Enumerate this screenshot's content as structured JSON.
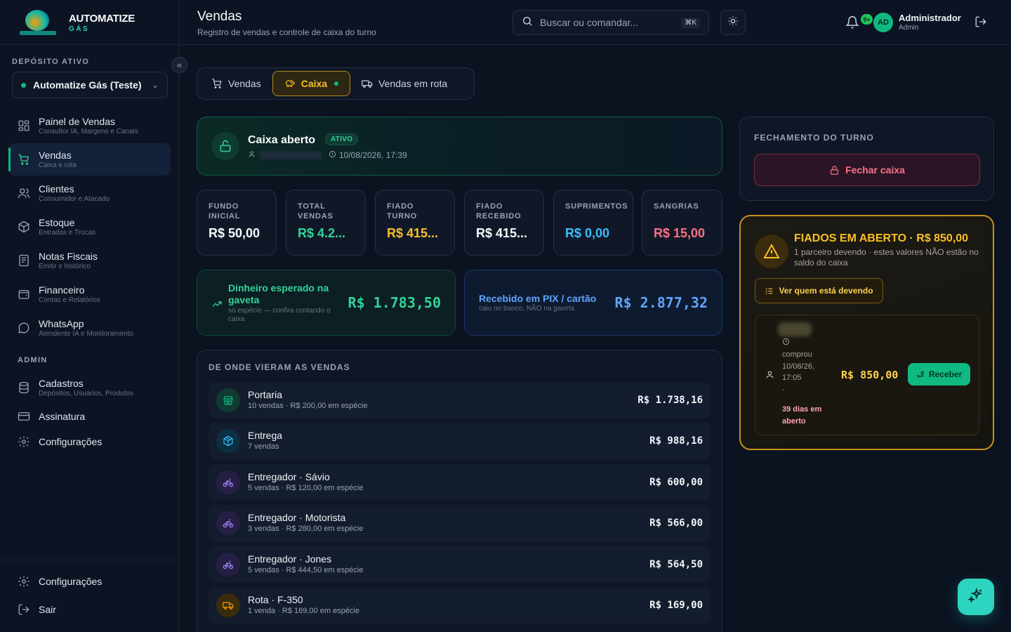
{
  "brand": {
    "title": "AUTOMATIZE",
    "subtitle": "GÁS",
    "logo_text": "AUTOMATIZE GÁS"
  },
  "sidebar": {
    "deposit_label": "DEPÓSITO ATIVO",
    "deposit_name": "Automatize Gás (Teste)",
    "items": [
      {
        "label": "Painel de Vendas",
        "sub": "Consultor IA, Margens e Canais",
        "icon": "dashboard-icon"
      },
      {
        "label": "Vendas",
        "sub": "Caixa e rota",
        "icon": "cart-icon",
        "active": true
      },
      {
        "label": "Clientes",
        "sub": "Consumidor e Atacado",
        "icon": "users-icon"
      },
      {
        "label": "Estoque",
        "sub": "Entradas e Trocas",
        "icon": "box-icon"
      },
      {
        "label": "Notas Fiscais",
        "sub": "Emitir e histórico",
        "icon": "receipt-icon"
      },
      {
        "label": "Financeiro",
        "sub": "Contas e Relatórios",
        "icon": "wallet-icon"
      },
      {
        "label": "WhatsApp",
        "sub": "Atendente IA e Monitoramento",
        "icon": "chat-icon"
      }
    ],
    "admin_label": "ADMIN",
    "admin_items": [
      {
        "label": "Cadastros",
        "sub": "Depósitos, Usuários, Produtos",
        "icon": "database-icon"
      },
      {
        "label": "Assinatura",
        "icon": "credit-card-icon"
      },
      {
        "label": "Configurações",
        "icon": "gear-icon"
      }
    ],
    "bottom_items": [
      {
        "label": "Configurações",
        "icon": "gear-icon"
      },
      {
        "label": "Sair",
        "icon": "logout-icon"
      }
    ]
  },
  "header": {
    "title": "Vendas",
    "subtitle": "Registro de vendas e controle de caixa do turno",
    "search_placeholder": "Buscar ou comandar...",
    "search_shortcut": "⌘K",
    "notif_badge": "9+",
    "user_initials": "AD",
    "user_name": "Administrador",
    "user_role": "Admin"
  },
  "tabs": [
    {
      "label": "Vendas",
      "icon": "cart-icon"
    },
    {
      "label": "Caixa",
      "icon": "piggy-bank-icon",
      "active": true
    },
    {
      "label": "Vendas em rota",
      "icon": "truck-icon"
    }
  ],
  "caixa": {
    "title": "Caixa aberto",
    "badge": "ATIVO",
    "opened_at": "10/08/2026, 17:39"
  },
  "stats": [
    {
      "label": "FUNDO INICIAL",
      "value": "R$ 50,00",
      "color": "#f8fafc"
    },
    {
      "label": "TOTAL VENDAS",
      "value": "R$ 4.2...",
      "color": "#34d399"
    },
    {
      "label": "FIADO TURNO",
      "value": "R$ 415...",
      "color": "#fbbf24"
    },
    {
      "label": "FIADO RECEBIDO",
      "value": "R$ 415...",
      "color": "#f8fafc"
    },
    {
      "label": "SUPRIMENTOS",
      "value": "R$ 0,00",
      "color": "#38bdf8"
    },
    {
      "label": "SANGRIAS",
      "value": "R$ 15,00",
      "color": "#fb7185"
    }
  ],
  "cash_expected": {
    "title": "Dinheiro esperado na gaveta",
    "sub": "só espécie — confira contando o caixa",
    "value": "R$ 1.783,50"
  },
  "pix_card": {
    "title": "Recebido em PIX / cartão",
    "sub": "caiu no banco, NÃO na gaveta",
    "value": "R$ 2.877,32"
  },
  "origins": {
    "title": "DE ONDE VIERAM AS VENDAS",
    "rows": [
      {
        "name": "Portaria",
        "sub": "10 vendas · R$ 200,00 em espécie",
        "value": "R$ 1.738,16",
        "icon": "store-icon",
        "color": "#10b981"
      },
      {
        "name": "Entrega",
        "sub": "7 vendas",
        "value": "R$ 988,16",
        "icon": "package-icon",
        "color": "#38bdf8"
      },
      {
        "name": "Entregador · Sávio",
        "sub": "5 vendas · R$ 120,00 em espécie",
        "value": "R$ 600,00",
        "icon": "bike-icon",
        "color": "#a78bfa"
      },
      {
        "name": "Entregador · Motorista",
        "sub": "3 vendas · R$ 280,00 em espécie",
        "value": "R$ 566,00",
        "icon": "bike-icon",
        "color": "#a78bfa"
      },
      {
        "name": "Entregador · Jones",
        "sub": "5 vendas · R$ 444,50 em espécie",
        "value": "R$ 564,50",
        "icon": "bike-icon",
        "color": "#a78bfa"
      },
      {
        "name": "Rota · F-350",
        "sub": "1 venda · R$ 169,00 em espécie",
        "value": "R$ 169,00",
        "icon": "truck-icon",
        "color": "#f59e0b"
      }
    ]
  },
  "fechamento": {
    "title": "FECHAMENTO DO TURNO",
    "button": "Fechar caixa"
  },
  "fiados": {
    "title": "FIADOS EM ABERTO · R$ 850,00",
    "sub": "1 parceiro devendo · estes valores NÃO estão no saldo do caixa",
    "button": "Ver quem está devendo",
    "debt": {
      "bought_label": "comprou",
      "date": "10/08/26, 17:05",
      "extra": "·",
      "days": "39 dias em aberto",
      "value": "R$ 850,00",
      "action": "Receber"
    }
  }
}
